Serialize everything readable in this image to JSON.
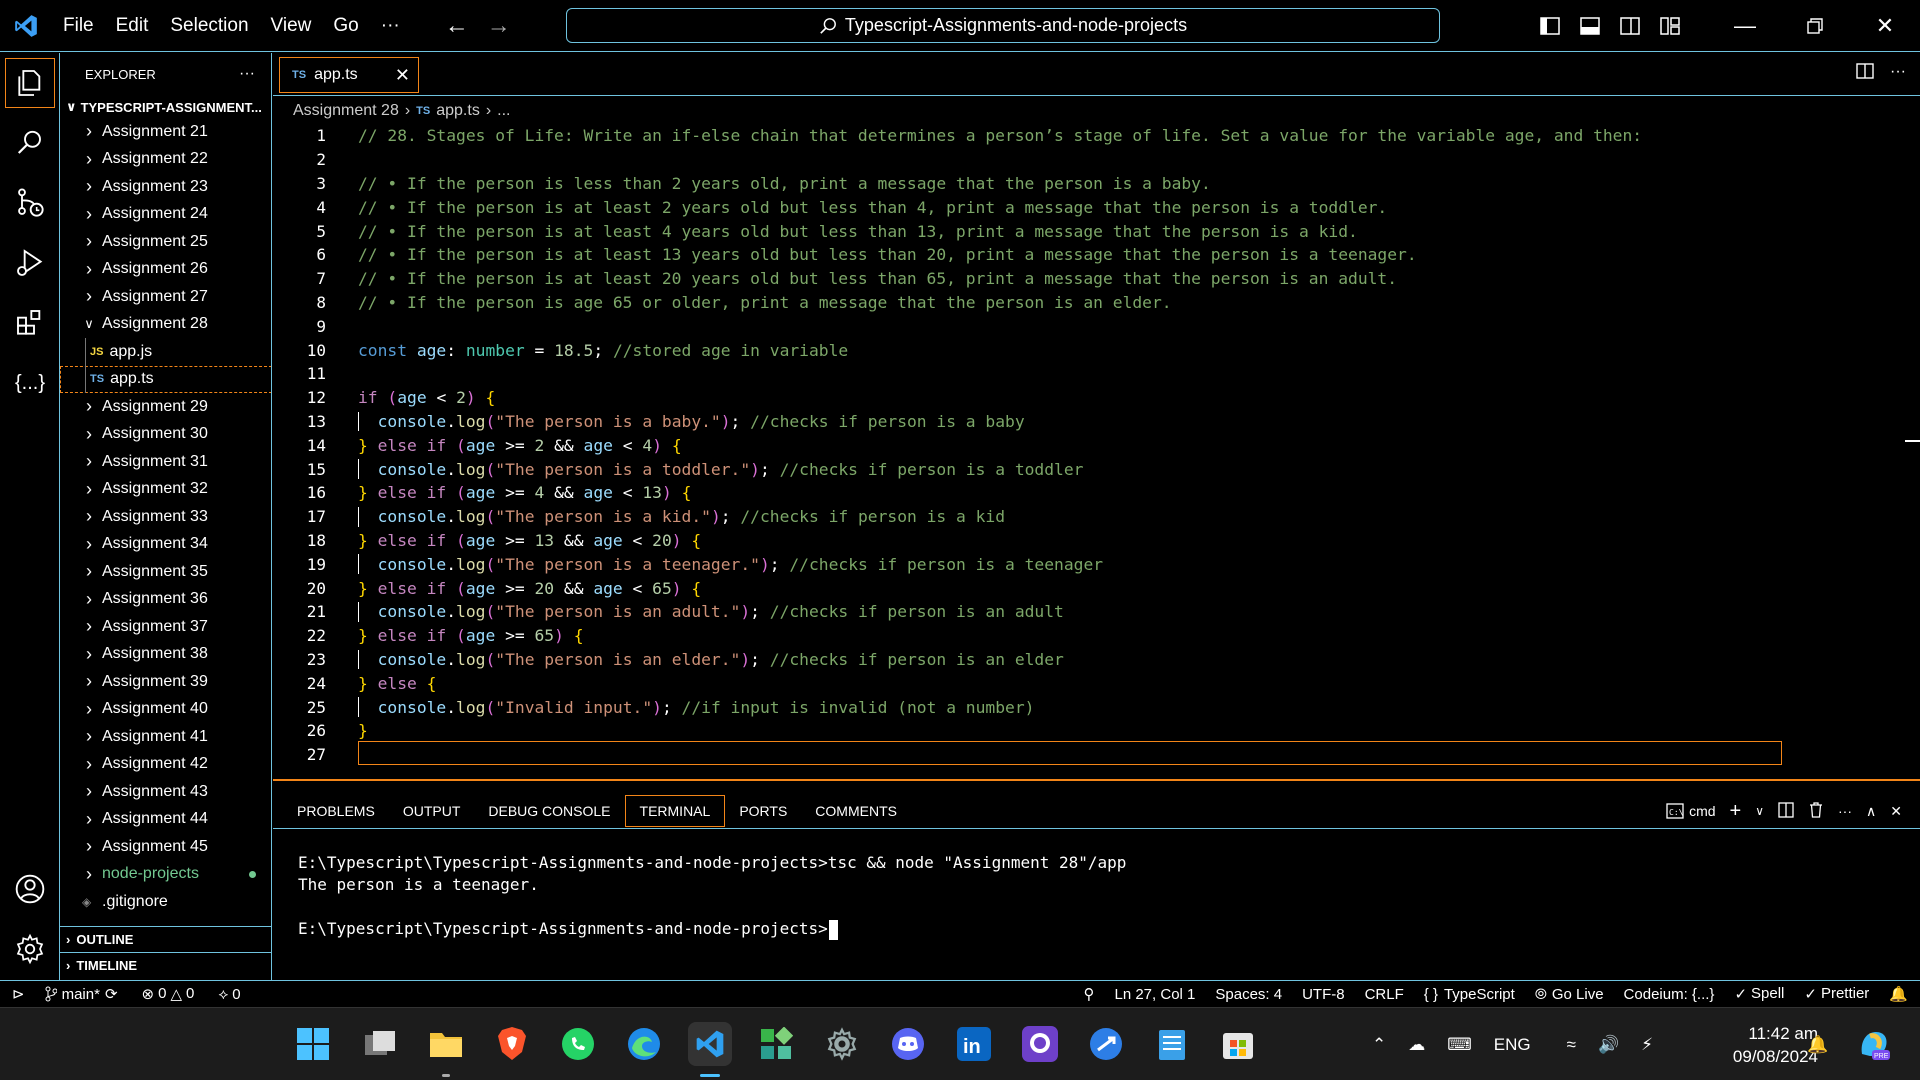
{
  "window": {
    "search_text": "Typescript-Assignments-and-node-projects",
    "menu": [
      "File",
      "Edit",
      "Selection",
      "View",
      "Go",
      "···"
    ]
  },
  "sidebar": {
    "title": "EXPLORER",
    "more": "···",
    "root": "TYPESCRIPT-ASSIGNMENT...",
    "items": [
      {
        "label": "Assignment 21"
      },
      {
        "label": "Assignment 22"
      },
      {
        "label": "Assignment 23"
      },
      {
        "label": "Assignment 24"
      },
      {
        "label": "Assignment 25"
      },
      {
        "label": "Assignment 26"
      },
      {
        "label": "Assignment 27"
      },
      {
        "label": "Assignment 28"
      },
      {
        "label": "app.js",
        "badge": "JS"
      },
      {
        "label": "app.ts",
        "badge": "TS"
      },
      {
        "label": "Assignment 29"
      },
      {
        "label": "Assignment 30"
      },
      {
        "label": "Assignment 31"
      },
      {
        "label": "Assignment 32"
      },
      {
        "label": "Assignment 33"
      },
      {
        "label": "Assignment 34"
      },
      {
        "label": "Assignment 35"
      },
      {
        "label": "Assignment 36"
      },
      {
        "label": "Assignment 37"
      },
      {
        "label": "Assignment 38"
      },
      {
        "label": "Assignment 39"
      },
      {
        "label": "Assignment 40"
      },
      {
        "label": "Assignment 41"
      },
      {
        "label": "Assignment 42"
      },
      {
        "label": "Assignment 43"
      },
      {
        "label": "Assignment 44"
      },
      {
        "label": "Assignment 45"
      },
      {
        "label": "node-projects"
      },
      {
        "label": ".gitignore"
      }
    ],
    "outline": "OUTLINE",
    "timeline": "TIMELINE"
  },
  "editor": {
    "tab_label": "app.ts",
    "tab_badge": "TS",
    "breadcrumb": [
      "Assignment 28",
      "app.ts",
      "..."
    ],
    "line_numbers": [
      "1",
      "2",
      "3",
      "4",
      "5",
      "6",
      "7",
      "8",
      "9",
      "10",
      "11",
      "12",
      "13",
      "14",
      "15",
      "16",
      "17",
      "18",
      "19",
      "20",
      "21",
      "22",
      "23",
      "24",
      "25",
      "26",
      "27"
    ],
    "comments": [
      "// 28. Stages of Life: Write an if-else chain that determines a person’s stage of life. Set a value for the variable age, and then:",
      "// • If the person is less than 2 years old, print a message that the person is a baby.",
      "// • If the person is at least 2 years old but less than 4, print a message that the person is a toddler.",
      "// • If the person is at least 4 years old but less than 13, print a message that the person is a kid.",
      "// • If the person is at least 13 years old but less than 20, print a message that the person is a teenager.",
      "// • If the person is at least 20 years old but less than 65, print a message that the person is an adult.",
      "// • If the person is age 65 or older, print a message that the person is an elder."
    ],
    "decl": {
      "kw": "const",
      "name": "age",
      "type": "number",
      "value": "18.5",
      "comment": "//stored age in variable"
    },
    "branches": [
      {
        "kw": "if",
        "cond": [
          [
            "age",
            "<",
            "2"
          ]
        ],
        "msg": "\"The person is a baby.\"",
        "comment": "//checks if person is a baby"
      },
      {
        "kw": "else if",
        "cond": [
          [
            "age",
            ">=",
            "2"
          ],
          [
            "age",
            "<",
            "4"
          ]
        ],
        "msg": "\"The person is a toddler.\"",
        "comment": "//checks if person is a toddler"
      },
      {
        "kw": "else if",
        "cond": [
          [
            "age",
            ">=",
            "4"
          ],
          [
            "age",
            "<",
            "13"
          ]
        ],
        "msg": "\"The person is a kid.\"",
        "comment": "//checks if person is a kid"
      },
      {
        "kw": "else if",
        "cond": [
          [
            "age",
            ">=",
            "13"
          ],
          [
            "age",
            "<",
            "20"
          ]
        ],
        "msg": "\"The person is a teenager.\"",
        "comment": "//checks if person is a teenager"
      },
      {
        "kw": "else if",
        "cond": [
          [
            "age",
            ">=",
            "20"
          ],
          [
            "age",
            "<",
            "65"
          ]
        ],
        "msg": "\"The person is an adult.\"",
        "comment": "//checks if person is an adult"
      },
      {
        "kw": "else if",
        "cond": [
          [
            "age",
            ">=",
            "65"
          ]
        ],
        "msg": "\"The person is an elder.\"",
        "comment": "//checks if person is an elder"
      },
      {
        "kw": "else",
        "cond": [],
        "msg": "\"Invalid input.\"",
        "comment": "//if input is invalid (not a number)"
      }
    ],
    "console_obj": "console",
    "console_fn": "log"
  },
  "panel": {
    "tabs": [
      "PROBLEMS",
      "OUTPUT",
      "DEBUG CONSOLE",
      "TERMINAL",
      "PORTS",
      "COMMENTS"
    ],
    "active_tab": "TERMINAL",
    "shell": "cmd",
    "terminal_lines": [
      "E:\\Typescript\\Typescript-Assignments-and-node-projects>tsc && node \"Assignment 28\"/app",
      "The person is a teenager.",
      "",
      "E:\\Typescript\\Typescript-Assignments-and-node-projects>"
    ]
  },
  "status": {
    "branch": "main*",
    "errors": "0",
    "warnings": "0",
    "ports": "0",
    "position": "Ln 27, Col 1",
    "spaces": "Spaces: 4",
    "encoding": "UTF-8",
    "eol": "CRLF",
    "language": "TypeScript",
    "golive": "Go Live",
    "codeium": "Codeium: {...}",
    "spell": "Spell",
    "prettier": "Prettier"
  },
  "taskbar": {
    "lang": "ENG",
    "time": "11:42 am",
    "date": "09/08/2024"
  },
  "colors": {
    "accent_border": "#6fc3df",
    "focus_border": "#f38518",
    "comment": "#7ca668",
    "keyword": "#569cd6",
    "control": "#c586c0",
    "string": "#ce9178"
  }
}
